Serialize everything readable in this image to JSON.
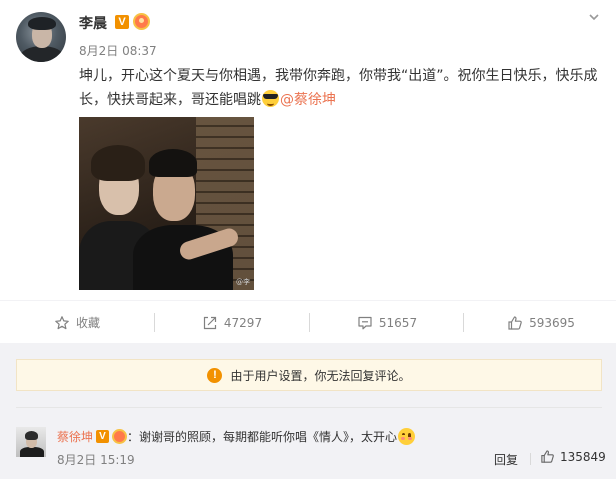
{
  "post": {
    "username": "李晨",
    "verified_badge": "V",
    "timestamp": "8月2日 08:37",
    "content_text": "坤儿，开心这个夏天与你相遇，我带你奔跑，你带我“出道”。祝你生日快乐，快乐成长，快扶哥起来，哥还能唱跳",
    "mention": "@蔡徐坤",
    "photo_watermark": "@李"
  },
  "actions": {
    "favorite_label": "收藏",
    "repost_count": "47297",
    "comment_count": "51657",
    "like_count": "593695"
  },
  "notice": {
    "icon": "!",
    "text": "由于用户设置，你无法回复评论。"
  },
  "comment": {
    "username": "蔡徐坤",
    "verified_badge": "V",
    "text": "：谢谢哥的照顾，每期都能听你唱《情人》，太开心",
    "timestamp": "8月2日 15:19",
    "reply_label": "回复",
    "like_count": "135849"
  },
  "colors": {
    "accent": "#eb7350",
    "verified": "#f29100",
    "notice_bg": "#fef8e7",
    "comment_bg": "#f2f2f5"
  },
  "icons": [
    "chevron-down-icon",
    "star-icon",
    "repost-icon",
    "comment-icon",
    "thumbs-up-icon",
    "warning-icon",
    "cool-emoji-icon",
    "blush-emoji-icon"
  ]
}
